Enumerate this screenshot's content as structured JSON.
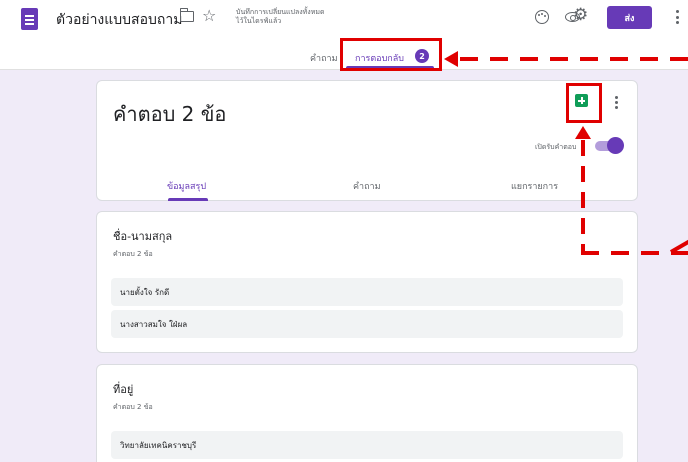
{
  "header": {
    "doc_title": "ตัวอย่างแบบสอบถาม",
    "saved_status_line1": "บันทึกการเปลี่ยนแปลงทั้งหมด",
    "saved_status_line2": "ไว้ในไดรฟ์แล้ว",
    "send_label": "ส่ง",
    "icons": [
      "form-doc-icon",
      "folder-icon",
      "star-icon",
      "palette-icon",
      "eye-icon",
      "gear-icon",
      "more-vert-icon"
    ]
  },
  "tabs": {
    "questions_label": "คำถาม",
    "responses_label": "การตอบกลับ",
    "responses_badge": "2",
    "active": "responses"
  },
  "responses_card": {
    "title": "คำตอบ 2 ข้อ",
    "accepting_label": "เปิดรับคำตอบ",
    "accepting_on": true,
    "subtabs": {
      "summary": "ข้อมูลสรุป",
      "question": "คำถาม",
      "individual": "แยกรายการ"
    },
    "active_subtab": "summary"
  },
  "questions": [
    {
      "title": "ชื่อ-นามสกุล",
      "count": "คำตอบ 2 ข้อ",
      "answers": [
        "นายตั้งใจ รักดี",
        "นางสาวสมใจ ใฝ่ผล"
      ]
    },
    {
      "title": "ที่อยู่",
      "count": "คำตอบ 2 ข้อ",
      "answers": [
        "วิทยาลัยเทคนิคราชบุรี"
      ]
    }
  ],
  "colors": {
    "accent": "#673ab7",
    "background": "#f0ebf8",
    "sheets_green": "#0f9d58",
    "annotation_red": "#e00000"
  }
}
